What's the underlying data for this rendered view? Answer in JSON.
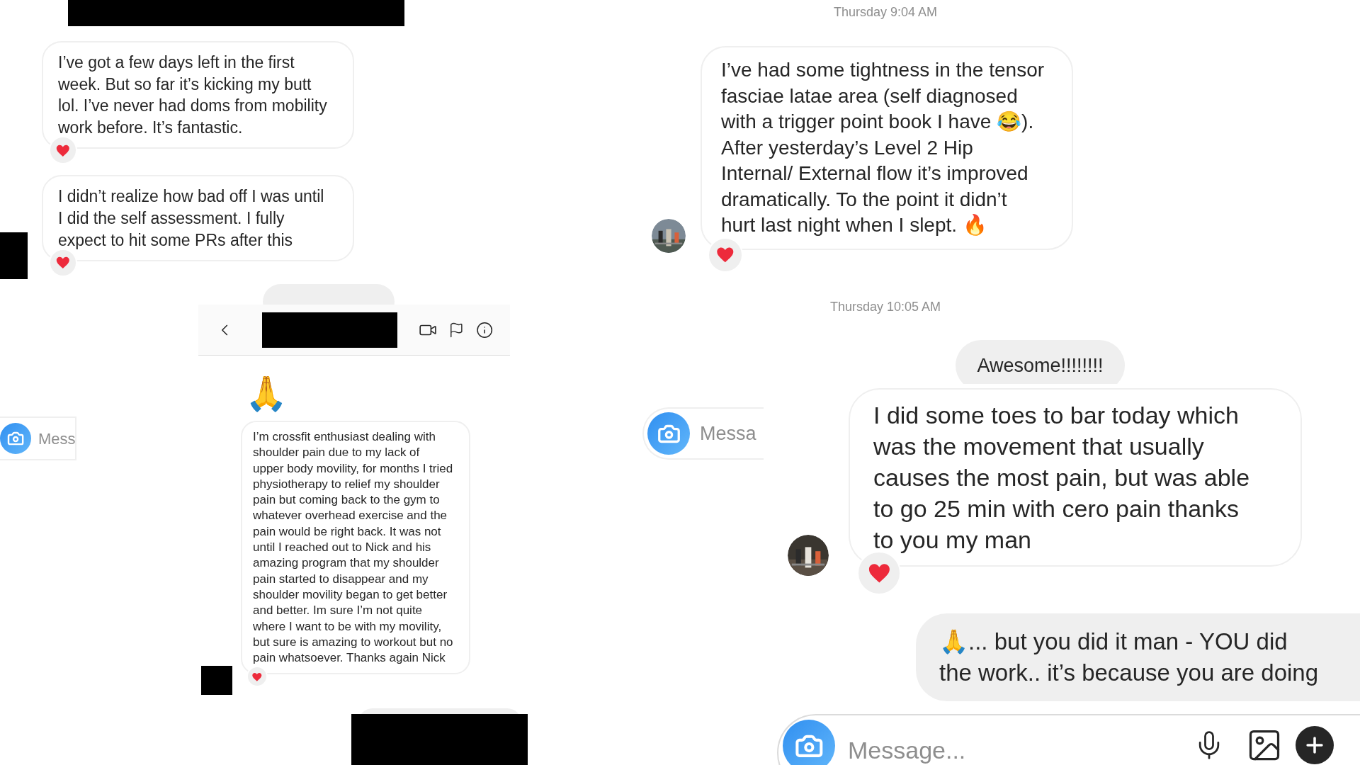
{
  "left_chat": {
    "messages": [
      {
        "text": "I’ve got a few days left in the first week. But so far it’s kicking my butt lol. I’ve never had doms from mobility work before. It’s fantastic.",
        "liked": true
      },
      {
        "text": "I didn’t realize how bad off I was until I did the self assessment. I fully expect to hit some PRs after this",
        "liked": true
      }
    ],
    "composer": {
      "placeholder": "Mess"
    }
  },
  "middle_chat": {
    "emoji": "🙏",
    "message": {
      "text": "I’m crossfit enthusiast dealing with shoulder pain due to my lack of upper body movility, for months I tried physiotherapy to relief my shoulder pain but coming back to the gym to whatever overhead exercise and the pain would be right back. It was not until I reached out to Nick and his amazing program that my shoulder pain started to disappear and my shoulder movility began to get better and better. Im sure I’m not quite where I want to be with my movility, but sure is amazing to workout but no pain whatsoever. Thanks again Nick",
      "liked": true
    }
  },
  "right_chat": {
    "items": [
      {
        "kind": "timestamp",
        "text": "Thursday 9:04 AM"
      },
      {
        "kind": "received",
        "text": "I’ve had some tightness in the tensor fasciae latae area (self diagnosed with a trigger point book I have 😂). After yesterday’s Level 2 Hip Internal/ External flow it’s improved dramatically. To the point it didn’t hurt last night when I slept. 🔥",
        "liked": true
      },
      {
        "kind": "timestamp",
        "text": "Thursday 10:05 AM"
      },
      {
        "kind": "sent",
        "text": "Awesome!!!!!!!!"
      }
    ],
    "composer": {
      "placeholder": "Messa"
    }
  },
  "bottom_chat": {
    "received": {
      "text": "I did some toes to bar today which was the movement that usually causes the most pain, but was able to go 25 min with cero pain thanks to you my man",
      "liked": true
    },
    "sent": {
      "lines": [
        "🙏... but you did it man - YOU did",
        "the work.. it’s because you are doing"
      ]
    },
    "composer": {
      "placeholder": "Message..."
    }
  }
}
